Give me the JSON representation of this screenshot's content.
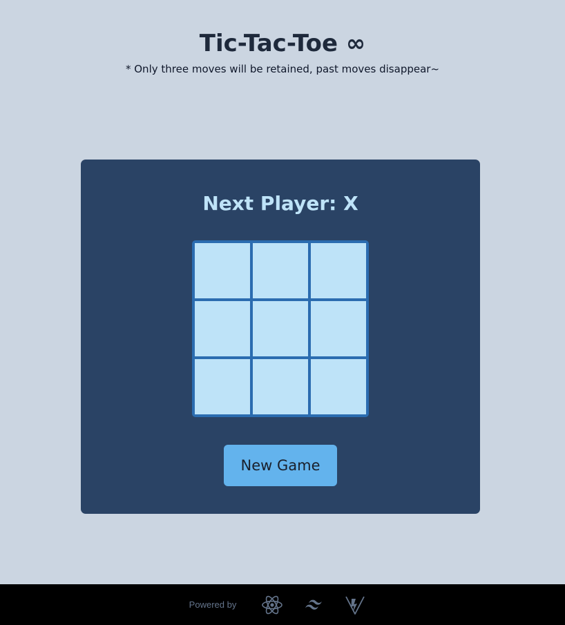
{
  "header": {
    "title": "Tic-Tac-Toe ∞",
    "subtitle": "* Only three moves will be retained, past moves disappear~"
  },
  "game": {
    "status": "Next Player: X",
    "board": [
      "",
      "",
      "",
      "",
      "",
      "",
      "",
      "",
      ""
    ],
    "new_game_label": "New Game"
  },
  "footer": {
    "powered_by": "Powered by",
    "icons": [
      "react-icon",
      "tailwind-icon",
      "vite-icon"
    ]
  },
  "colors": {
    "background": "#cbd5e1",
    "card": "#2a4365",
    "board_border": "#2b6cb0",
    "cell": "#bee3f8",
    "status_text": "#bee3f8",
    "button": "#63b3ed",
    "footer": "#000000",
    "footer_icon": "#64748b"
  }
}
